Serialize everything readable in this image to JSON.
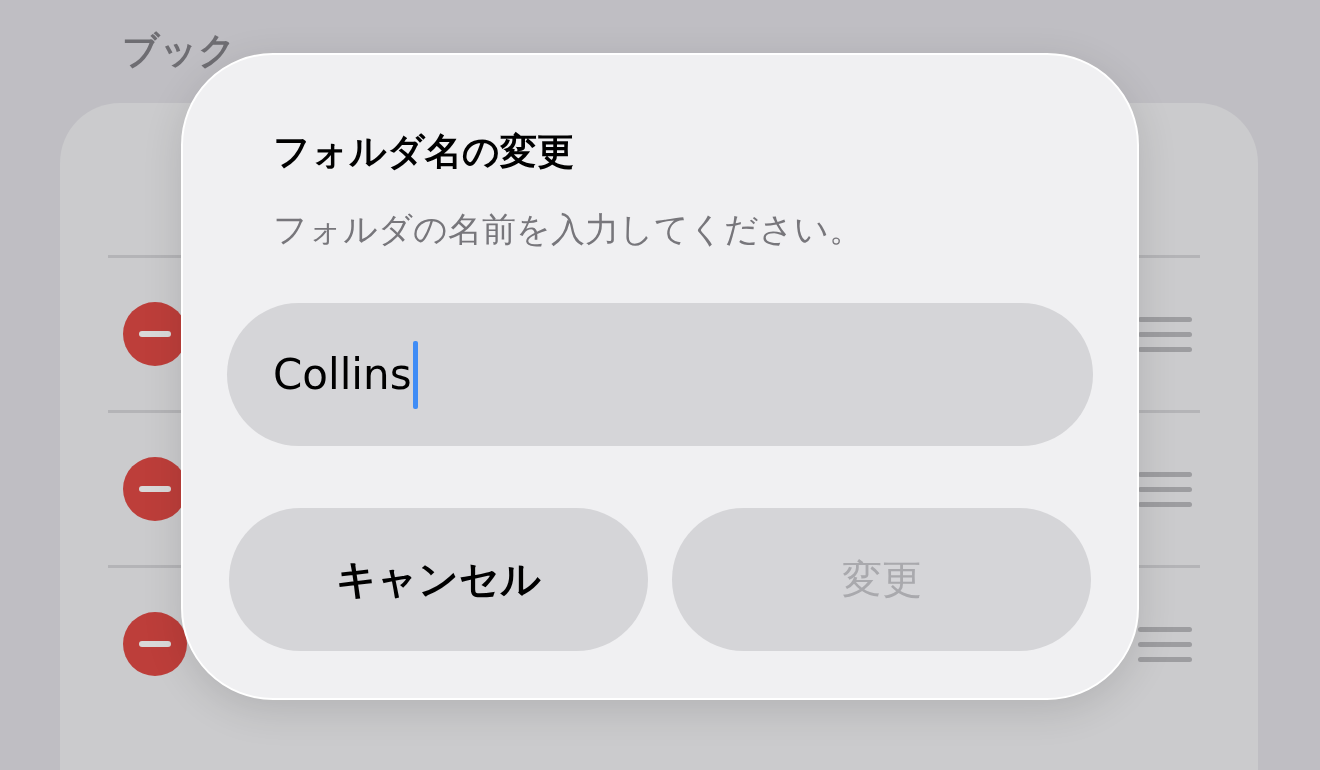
{
  "background": {
    "title": "ブック",
    "rows": [
      {
        "kind": "editable"
      },
      {
        "kind": "editable"
      },
      {
        "kind": "editable"
      }
    ]
  },
  "dialog": {
    "title": "フォルダ名の変更",
    "message": "フォルダの名前を入力してください。",
    "field": {
      "value": "Collins",
      "focused": true
    },
    "buttons": [
      {
        "label": "キャンセル",
        "disabled": false
      },
      {
        "label": "変更",
        "disabled": true
      }
    ]
  }
}
